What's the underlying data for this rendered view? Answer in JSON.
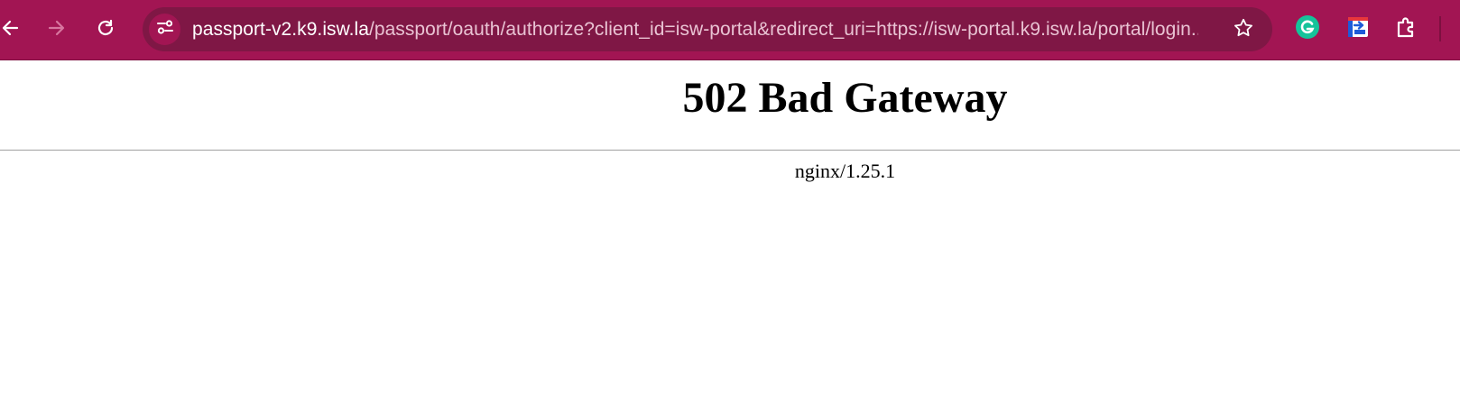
{
  "browser": {
    "url_host": "passport-v2.k9.isw.la",
    "url_path": "/passport/oauth/authorize?client_id=isw-portal&redirect_uri=https://isw-portal.k9.isw.la/portal/login...",
    "toolbar_color": "#a21553",
    "omnibox_color": "#7f1745",
    "icons": [
      "back-icon",
      "forward-icon",
      "reload-icon",
      "site-info-icon",
      "bookmark-star-icon",
      "grammarly-extension-icon",
      "screen-capture-extension-icon",
      "extensions-puzzle-icon"
    ]
  },
  "page": {
    "heading": "502 Bad Gateway",
    "server": "nginx/1.25.1"
  }
}
